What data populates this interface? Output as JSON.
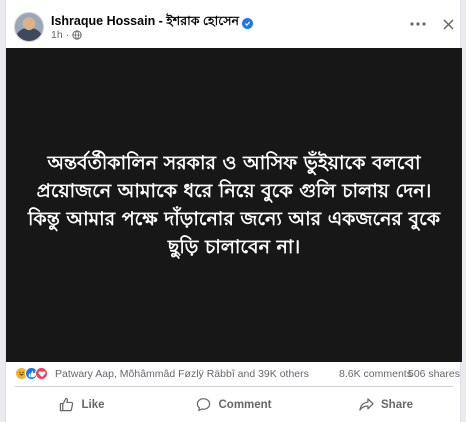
{
  "post": {
    "author": "Ishraque Hossain - ইশরাক হোসেন",
    "time": "1h",
    "meta_separator": "·",
    "icons": {
      "verified": "verified-badge-icon",
      "privacy": "globe-icon",
      "more": "more-options-icon",
      "close": "close-icon"
    },
    "image_text": "অন্তর্বর্তীকালিন সরকার ও আসিফ ভুঁইয়াকে বলবো প্রয়োজনে আমাকে ধরে নিয়ে বুকে গুলি চালায় দেন। কিন্তু আমার পক্ষে দাঁড়ানোর জন্যে আর একজনের বুকে ছুড়ি চালাবেন না।"
  },
  "stats": {
    "reactions": [
      "haha-icon",
      "like-icon",
      "love-icon"
    ],
    "reaction_names": "Patwary Aap, Mõhâmmâd Føzlÿ Räbbî and 39K others",
    "comments": "8.6K comments",
    "shares": "506 shares"
  },
  "actions": {
    "like": "Like",
    "comment": "Comment",
    "share": "Share"
  },
  "colors": {
    "accent": "#1877f2",
    "image_bg": "#171717",
    "secondary_text": "#65676b"
  }
}
